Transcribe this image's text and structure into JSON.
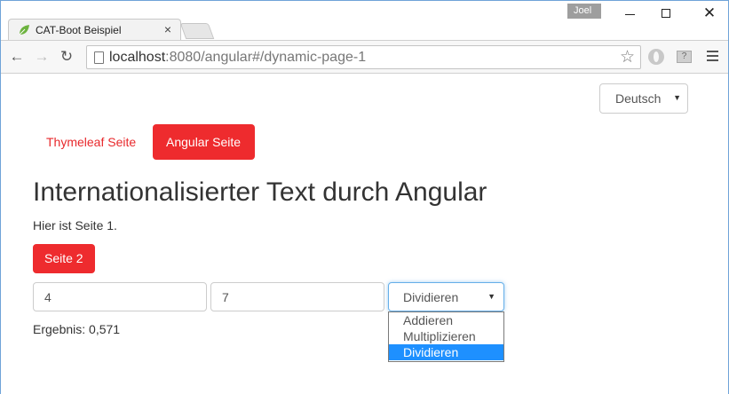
{
  "browser": {
    "tab_title": "CAT-Boot Beispiel",
    "tab_close": "×",
    "user": "Joel",
    "url_host": "localhost",
    "url_rest": ":8080/angular#/dynamic-page-1",
    "ext2_label": "?"
  },
  "page": {
    "language": "Deutsch",
    "nav": {
      "thymeleaf": "Thymeleaf Seite",
      "angular": "Angular Seite"
    },
    "title": "Internationalisierter Text durch Angular",
    "text": "Hier ist Seite 1.",
    "page2_button": "Seite 2",
    "input1": "4",
    "input2": "7",
    "operation": "Dividieren",
    "operation_options": [
      "Addieren",
      "Multiplizieren",
      "Dividieren"
    ],
    "result": "Ergebnis: 0,571"
  },
  "colors": {
    "accent": "#ee2b2e",
    "selection": "#1e90ff",
    "focus": "#66afe9"
  }
}
